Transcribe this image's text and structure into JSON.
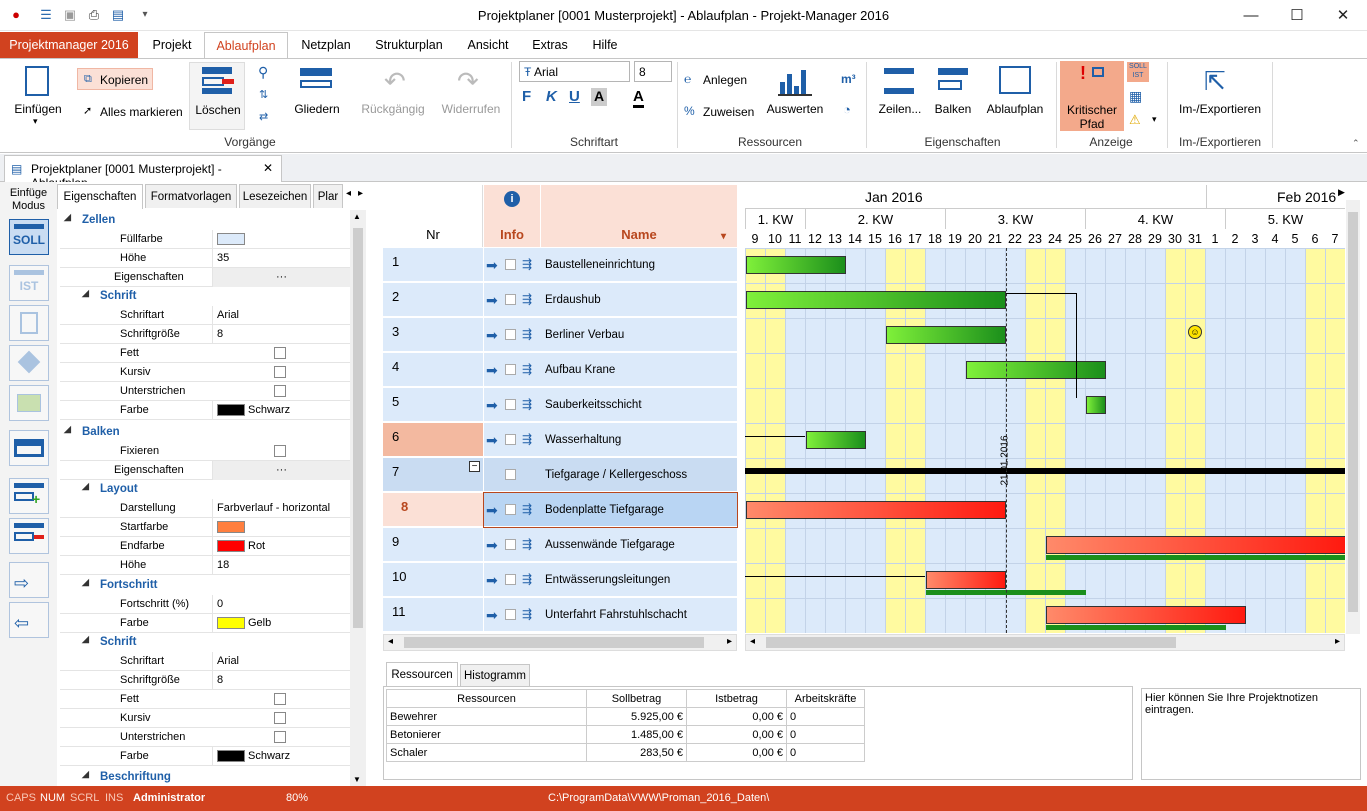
{
  "window": {
    "title": "Projektplaner [0001 Musterprojekt] - Ablaufplan - Projekt-Manager 2016",
    "min": "—",
    "max": "☐",
    "close": "✕"
  },
  "ribbon_tabs": {
    "app": "Projektmanager 2016",
    "tabs": [
      "Projekt",
      "Ablaufplan",
      "Netzplan",
      "Strukturplan",
      "Ansicht",
      "Extras",
      "Hilfe"
    ]
  },
  "ribbon": {
    "einfuegen": "Einfügen",
    "kopieren": "Kopieren",
    "alles_markieren": "Alles markieren",
    "loeschen": "Löschen",
    "gliedern": "Gliedern",
    "rueckgaengig": "Rückgängig",
    "widerrufen": "Widerrufen",
    "font_name": "Arial",
    "font_size": "8",
    "bold": "F",
    "italic": "K",
    "underline": "U",
    "fill_a": "A",
    "color_a": "A",
    "anlegen": "Anlegen",
    "zuweisen": "Zuweisen",
    "auswerten": "Auswerten",
    "m3": "m³",
    "zeilen": "Zeilen...",
    "balken": "Balken",
    "ablaufplan": "Ablaufplan",
    "kritischer": "Kritischer",
    "pfad": "Pfad",
    "soll_ist": "SOLL IST",
    "imexport": "Im-/Exportieren",
    "groups": {
      "vorgaenge": "Vorgänge",
      "schriftart": "Schriftart",
      "ressourcen": "Ressourcen",
      "eigenschaften": "Eigenschaften",
      "anzeige": "Anzeige",
      "imexport": "Im-/Exportieren"
    }
  },
  "doc_tab": {
    "label": "Projektplaner [0001 Musterprojekt] - Ablaufplan",
    "close": "✕"
  },
  "mode": {
    "label1": "Einfüge",
    "label2": "Modus",
    "soll": "SOLL",
    "ist": "IST"
  },
  "props": {
    "tabs": [
      "Eigenschaften",
      "Formatvorlagen",
      "Lesezeichen",
      "Plar"
    ],
    "sections": {
      "zellen": "Zellen",
      "schrift": "Schrift",
      "balken": "Balken",
      "layout": "Layout",
      "fortschritt": "Fortschritt",
      "schrift2": "Schrift",
      "beschriftung": "Beschriftung"
    },
    "rows": {
      "fuellfarbe": "Füllfarbe",
      "hoehe": "Höhe",
      "hoehe_v": "35",
      "eigenschaften": "Eigenschaften",
      "dots": "···",
      "schriftart": "Schriftart",
      "schriftart_v": "Arial",
      "schriftgroesse": "Schriftgröße",
      "schriftgroesse_v": "8",
      "fett": "Fett",
      "kursiv": "Kursiv",
      "unterstrichen": "Unterstrichen",
      "farbe": "Farbe",
      "farbe_v": "Schwarz",
      "fixieren": "Fixieren",
      "darstellung": "Darstellung",
      "darstellung_v": "Farbverlauf - horizontal",
      "startfarbe": "Startfarbe",
      "endfarbe": "Endfarbe",
      "endfarbe_v": "Rot",
      "hoehe2_v": "18",
      "fortschritt": "Fortschritt (%)",
      "fortschritt_v": "0",
      "farbe_gelb": "Gelb"
    }
  },
  "grid": {
    "headers": {
      "nr": "Nr",
      "info": "Info",
      "name": "Name"
    },
    "rows": [
      {
        "nr": "1",
        "name": "Baustelleneinrichtung"
      },
      {
        "nr": "2",
        "name": "Erdaushub"
      },
      {
        "nr": "3",
        "name": "Berliner Verbau"
      },
      {
        "nr": "4",
        "name": "Aufbau Krane"
      },
      {
        "nr": "5",
        "name": "Sauberkeitsschicht"
      },
      {
        "nr": "6",
        "name": "Wasserhaltung"
      },
      {
        "nr": "7",
        "name": "Tiefgarage / Kellergeschoss"
      },
      {
        "nr": "8",
        "name": "Bodenplatte Tiefgarage"
      },
      {
        "nr": "9",
        "name": "Aussenwände Tiefgarage"
      },
      {
        "nr": "10",
        "name": "Entwässerungsleitungen"
      },
      {
        "nr": "11",
        "name": "Unterfahrt Fahrstuhlschacht"
      }
    ]
  },
  "gantt": {
    "months": [
      "Jan 2016",
      "Feb 2016"
    ],
    "weeks": [
      "1. KW",
      "2. KW",
      "3. KW",
      "4. KW",
      "5. KW"
    ],
    "days": [
      "9",
      "10",
      "11",
      "12",
      "13",
      "14",
      "15",
      "16",
      "17",
      "18",
      "19",
      "20",
      "21",
      "22",
      "23",
      "24",
      "25",
      "26",
      "27",
      "28",
      "29",
      "30",
      "31",
      "1",
      "2",
      "3",
      "4",
      "5",
      "6",
      "7"
    ],
    "today_label": "21.01.2016"
  },
  "bottom": {
    "tabs": [
      "Ressourcen",
      "Histogramm"
    ],
    "table_headers": [
      "Ressourcen",
      "Sollbetrag",
      "Istbetrag",
      "Arbeitskräfte"
    ],
    "table_rows": [
      [
        "Bewehrer",
        "5.925,00 €",
        "0,00 €",
        "0"
      ],
      [
        "Betonierer",
        "1.485,00 €",
        "0,00 €",
        "0"
      ],
      [
        "Schaler",
        "283,50 €",
        "0,00 €",
        "0"
      ]
    ],
    "notes": "Hier können Sie Ihre Projektnotizen eintragen."
  },
  "status": {
    "caps": "CAPS",
    "num": "NUM",
    "scrl": "SCRL",
    "ins": "INS",
    "user": "Administrator",
    "zoom": "80%",
    "path": "C:\\ProgramData\\VWW\\Proman_2016_Daten\\"
  },
  "colors": {
    "accent": "#d1421f",
    "grid_blue": "#dceafa",
    "weekend": "#fffaa0",
    "bar_green": "#2fa41f",
    "bar_red": "#ff2a1a"
  }
}
